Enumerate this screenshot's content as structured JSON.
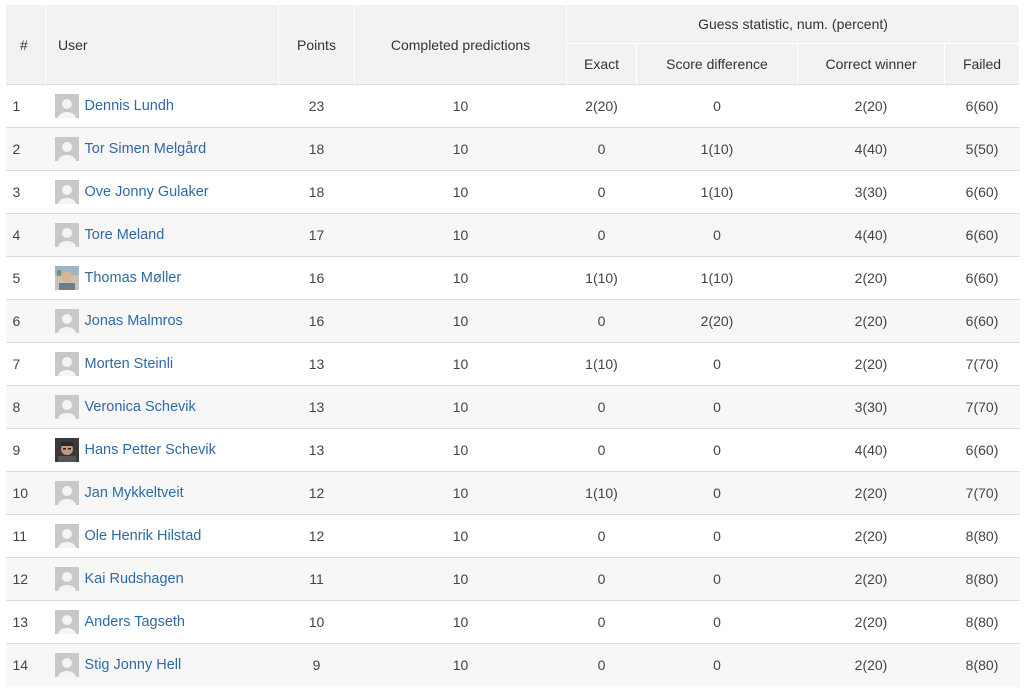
{
  "headers": {
    "rank": "#",
    "user": "User",
    "points": "Points",
    "completed": "Completed predictions",
    "guess_group": "Guess statistic, num. (percent)",
    "exact": "Exact",
    "score_difference": "Score difference",
    "correct_winner": "Correct winner",
    "failed": "Failed"
  },
  "rows": [
    {
      "rank": "1",
      "name": "Dennis Lundh",
      "avatar": "default",
      "points": "23",
      "completed": "10",
      "exact": "2(20)",
      "score_difference": "0",
      "correct_winner": "2(20)",
      "failed": "6(60)"
    },
    {
      "rank": "2",
      "name": "Tor Simen Melgård",
      "avatar": "default",
      "points": "18",
      "completed": "10",
      "exact": "0",
      "score_difference": "1(10)",
      "correct_winner": "4(40)",
      "failed": "5(50)"
    },
    {
      "rank": "3",
      "name": "Ove Jonny Gulaker",
      "avatar": "default",
      "points": "18",
      "completed": "10",
      "exact": "0",
      "score_difference": "1(10)",
      "correct_winner": "3(30)",
      "failed": "6(60)"
    },
    {
      "rank": "4",
      "name": "Tore Meland",
      "avatar": "default",
      "points": "17",
      "completed": "10",
      "exact": "0",
      "score_difference": "0",
      "correct_winner": "4(40)",
      "failed": "6(60)"
    },
    {
      "rank": "5",
      "name": "Thomas Møller",
      "avatar": "photo-light",
      "points": "16",
      "completed": "10",
      "exact": "1(10)",
      "score_difference": "1(10)",
      "correct_winner": "2(20)",
      "failed": "6(60)"
    },
    {
      "rank": "6",
      "name": "Jonas Malmros",
      "avatar": "default",
      "points": "16",
      "completed": "10",
      "exact": "0",
      "score_difference": "2(20)",
      "correct_winner": "2(20)",
      "failed": "6(60)"
    },
    {
      "rank": "7",
      "name": "Morten Steinli",
      "avatar": "default",
      "points": "13",
      "completed": "10",
      "exact": "1(10)",
      "score_difference": "0",
      "correct_winner": "2(20)",
      "failed": "7(70)"
    },
    {
      "rank": "8",
      "name": "Veronica Schevik",
      "avatar": "default",
      "points": "13",
      "completed": "10",
      "exact": "0",
      "score_difference": "0",
      "correct_winner": "3(30)",
      "failed": "7(70)"
    },
    {
      "rank": "9",
      "name": "Hans Petter Schevik",
      "avatar": "photo-dark",
      "points": "13",
      "completed": "10",
      "exact": "0",
      "score_difference": "0",
      "correct_winner": "4(40)",
      "failed": "6(60)"
    },
    {
      "rank": "10",
      "name": "Jan Mykkeltveit",
      "avatar": "default",
      "points": "12",
      "completed": "10",
      "exact": "1(10)",
      "score_difference": "0",
      "correct_winner": "2(20)",
      "failed": "7(70)"
    },
    {
      "rank": "11",
      "name": "Ole Henrik Hilstad",
      "avatar": "default",
      "points": "12",
      "completed": "10",
      "exact": "0",
      "score_difference": "0",
      "correct_winner": "2(20)",
      "failed": "8(80)"
    },
    {
      "rank": "12",
      "name": "Kai Rudshagen",
      "avatar": "default",
      "points": "11",
      "completed": "10",
      "exact": "0",
      "score_difference": "0",
      "correct_winner": "2(20)",
      "failed": "8(80)"
    },
    {
      "rank": "13",
      "name": "Anders Tagseth",
      "avatar": "default",
      "points": "10",
      "completed": "10",
      "exact": "0",
      "score_difference": "0",
      "correct_winner": "2(20)",
      "failed": "8(80)"
    },
    {
      "rank": "14",
      "name": "Stig Jonny Hell",
      "avatar": "default",
      "points": "9",
      "completed": "10",
      "exact": "0",
      "score_difference": "0",
      "correct_winner": "2(20)",
      "failed": "8(80)"
    }
  ],
  "colors": {
    "header_bg": "#f2f2f2",
    "link": "#2e6aa8",
    "row_alt": "#f7f7f7",
    "border": "#dddddd"
  }
}
